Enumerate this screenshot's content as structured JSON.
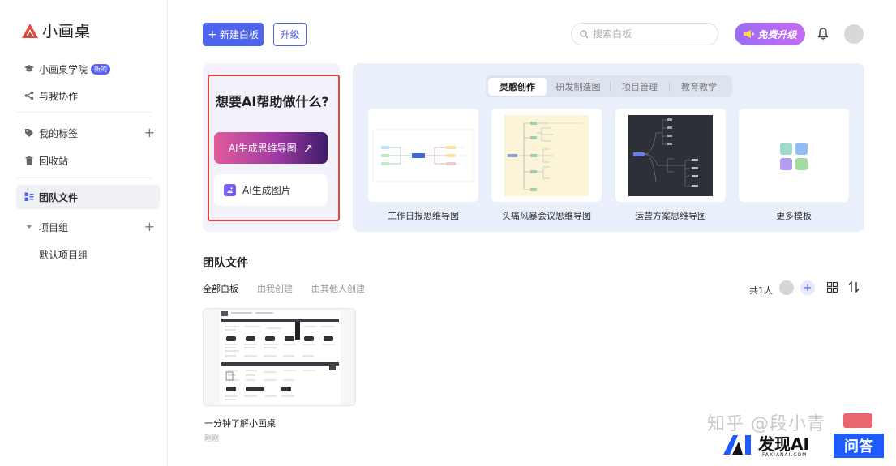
{
  "app": {
    "logo_text": "小画桌"
  },
  "sidebar": {
    "items": [
      {
        "label": "小画桌学院",
        "badge": "新的"
      },
      {
        "label": "与我协作"
      },
      {
        "label": "我的标签"
      },
      {
        "label": "回收站"
      },
      {
        "label": "团队文件"
      },
      {
        "label": "项目组"
      },
      {
        "label": "默认项目组"
      }
    ]
  },
  "header": {
    "new_board": "新建白板",
    "upgrade": "升级",
    "search_placeholder": "搜索白板",
    "free_upgrade": "免费升级"
  },
  "ai": {
    "title": "想要AI帮助做什么?",
    "mind_map_btn": "AI生成思维导图",
    "mind_map_arrow": "↗",
    "image_btn": "AI生成图片"
  },
  "templates": {
    "tabs": [
      "灵感创作",
      "研发制造图",
      "项目管理",
      "教育教学"
    ],
    "active_tab": "灵感创作",
    "cards": [
      "工作日报思维导图",
      "头痛风暴会议思维导图",
      "运营方案思维导图",
      "更多模板"
    ]
  },
  "team": {
    "title": "团队文件",
    "filters": [
      "全部白板",
      "由我创建",
      "由其他人创建"
    ],
    "member_count": "共1人",
    "files": [
      {
        "name": "一分钟了解小画桌",
        "time": "刚刚"
      }
    ]
  },
  "watermark": {
    "zhihu": "知乎 @段小青",
    "brand_ai": "AI",
    "brand_name": "发现AI",
    "brand_sub": "FAXIANAI.COM",
    "brand_qa": "问答"
  },
  "colors": {
    "primary": "#4e64ee",
    "highlight_frame": "#e4453a",
    "template_bg": "#e9f0fb",
    "ai_bg": "#f3f2fb"
  }
}
